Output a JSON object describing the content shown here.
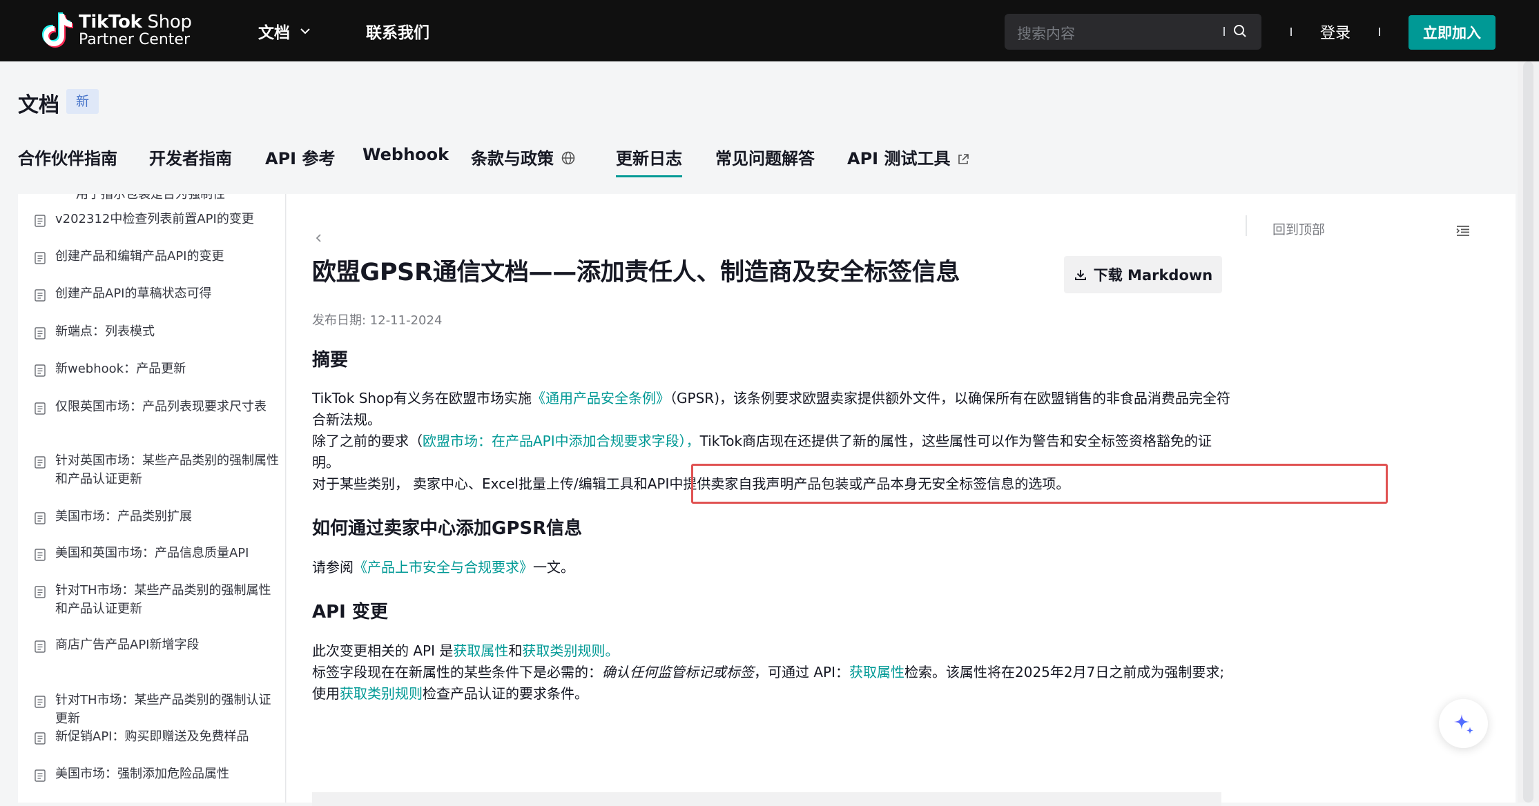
{
  "brand": {
    "name_bold": "TikTok",
    "name_rest": " Shop",
    "subtitle": "Partner Center"
  },
  "topnav": {
    "docs": "文档",
    "contact": "联系我们"
  },
  "search": {
    "placeholder": "搜索内容"
  },
  "auth": {
    "login": "登录",
    "join": "立即加入"
  },
  "docs_header": {
    "title": "文档",
    "badge": "新"
  },
  "tabs": [
    {
      "label": "合作伙伴指南"
    },
    {
      "label": "开发者指南"
    },
    {
      "label": "API 参考"
    },
    {
      "label": "Webhook"
    },
    {
      "label": "条款与政策"
    },
    {
      "label": "更新日志"
    },
    {
      "label": "常见问题解答"
    },
    {
      "label": "API 测试工具"
    }
  ],
  "sidebar": {
    "cut_top": "用于指示包装是否为强制性",
    "items": [
      {
        "label": "v202312中检查列表前置API的变更"
      },
      {
        "label": "创建产品和编辑产品API的变更"
      },
      {
        "label": "创建产品API的草稿状态可得"
      },
      {
        "label": "新端点：列表模式"
      },
      {
        "label": "新webhook：产品更新"
      },
      {
        "label": "仅限英国市场：产品列表现要求尺寸表"
      },
      {
        "label": "针对英国市场：某些产品类别的强制属性和产品认证更新"
      },
      {
        "label": "美国市场：产品类别扩展"
      },
      {
        "label": "美国和英国市场：产品信息质量API"
      },
      {
        "label": "针对TH市场：某些产品类别的强制属性和产品认证更新"
      },
      {
        "label": "商店广告产品API新增字段"
      },
      {
        "label": "针对TH市场：某些产品类别的强制认证更新"
      },
      {
        "label": "新促销API：购买即赠送及免费样品"
      },
      {
        "label": "美国市场：强制添加危险品属性"
      }
    ]
  },
  "article": {
    "title": "欧盟GPSR通信文档——添加责任人、制造商及安全标签信息",
    "download": "下载 Markdown",
    "published": "发布日期: 12-11-2024",
    "summary_heading": "摘要",
    "p1_a": "TikTok Shop有义务在欧盟市场实施",
    "p1_link": "《通用产品安全条例》",
    "p1_b": "（GPSR)，该条例要求欧盟卖家提供额外文件，以确保所有在欧盟销售的非食品消费品完全符合新法规。",
    "p2_a": "除了之前的要求（",
    "p2_link": "欧盟市场：在产品API中添加合规要求字段），",
    "p2_b": "TikTok商店现在还提供了新的属性，这些属性可以作为警告和安全标签资格豁免的证明。",
    "p3_a": "对于某些类别，",
    "p3_b": "卖家中心、Excel批量上传/编辑工具和API中提供卖家自我声明产品包装或产品本身无安全标签信息的选项。",
    "how_heading": "如何通过卖家中心添加GPSR信息",
    "how_a": "请参阅",
    "how_link": "《产品上市安全与合规要求》",
    "how_b": "一文。",
    "api_heading": "API 变更",
    "api1_a": "此次变更相关的 API 是",
    "api1_link1": "获取属性",
    "api1_and": "和",
    "api1_link2": "获取类别规则。",
    "api2_a": "标签字段现在在新属性的某些条件下是必需的：",
    "api2_em": "确认任何监管标记或标签",
    "api2_b": "，可通过 API：",
    "api2_link1": "获取属性",
    "api2_c": "检索。该属性将在2025年2月7日之前成为强制要求;使用",
    "api2_link2": "获取类别规则",
    "api2_d": "检查产品认证的要求条件。"
  },
  "toc": {
    "back_to_top": "回到顶部"
  },
  "colors": {
    "accent": "#009995",
    "topbar": "#101010",
    "highlight": "#e05252"
  }
}
